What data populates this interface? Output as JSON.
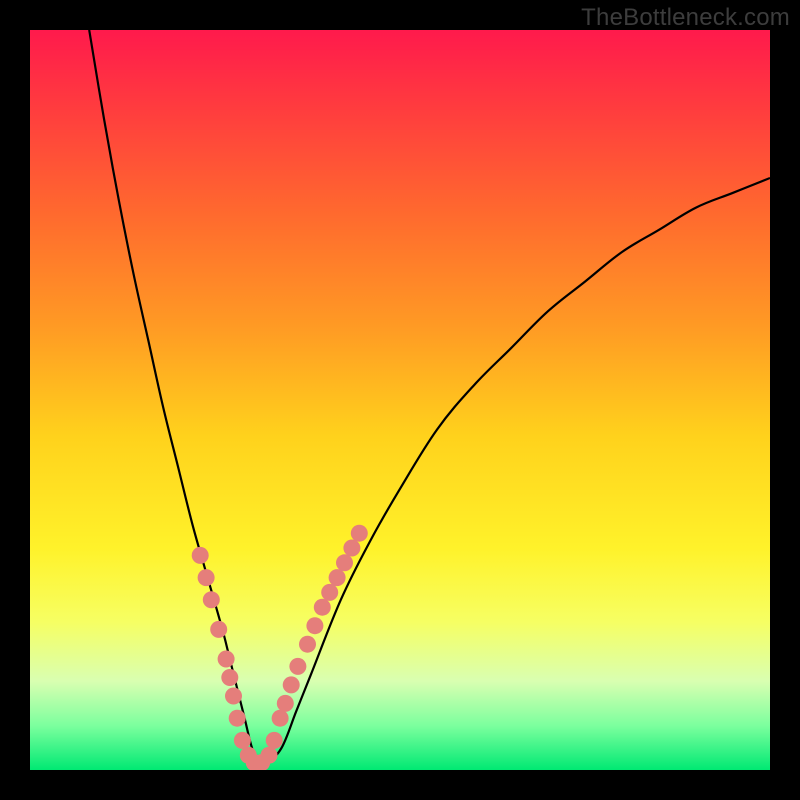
{
  "watermark": "TheBottleneck.com",
  "colors": {
    "background": "#000000",
    "curve_stroke": "#000000",
    "dot_fill": "#e57e7b",
    "gradient_stops": [
      {
        "offset": 0.0,
        "color": "#ff1a4c"
      },
      {
        "offset": 0.1,
        "color": "#ff3a3f"
      },
      {
        "offset": 0.25,
        "color": "#ff6a2e"
      },
      {
        "offset": 0.4,
        "color": "#ff9a24"
      },
      {
        "offset": 0.55,
        "color": "#ffd21c"
      },
      {
        "offset": 0.7,
        "color": "#fff22a"
      },
      {
        "offset": 0.8,
        "color": "#f6ff63"
      },
      {
        "offset": 0.88,
        "color": "#d9ffb1"
      },
      {
        "offset": 0.94,
        "color": "#7cff9e"
      },
      {
        "offset": 1.0,
        "color": "#00e973"
      }
    ]
  },
  "chart_data": {
    "type": "line",
    "title": "",
    "xlabel": "",
    "ylabel": "",
    "xlim": [
      0,
      100
    ],
    "ylim": [
      0,
      100
    ],
    "series": [
      {
        "name": "bottleneck-curve",
        "x": [
          8,
          10,
          12,
          14,
          16,
          18,
          20,
          22,
          24,
          26,
          27,
          28,
          29,
          30,
          31,
          32,
          34,
          36,
          38,
          42,
          46,
          50,
          55,
          60,
          65,
          70,
          75,
          80,
          85,
          90,
          95,
          100
        ],
        "y": [
          100,
          88,
          77,
          67,
          58,
          49,
          41,
          33,
          26,
          19,
          15,
          11,
          7,
          3,
          1,
          1,
          3,
          8,
          13,
          23,
          31,
          38,
          46,
          52,
          57,
          62,
          66,
          70,
          73,
          76,
          78,
          80
        ]
      }
    ],
    "markers": {
      "name": "highlight-dots",
      "points": [
        {
          "x": 23.0,
          "y": 29
        },
        {
          "x": 23.8,
          "y": 26
        },
        {
          "x": 24.5,
          "y": 23
        },
        {
          "x": 25.5,
          "y": 19
        },
        {
          "x": 26.5,
          "y": 15
        },
        {
          "x": 27.0,
          "y": 12.5
        },
        {
          "x": 27.5,
          "y": 10
        },
        {
          "x": 28.0,
          "y": 7
        },
        {
          "x": 28.7,
          "y": 4
        },
        {
          "x": 29.5,
          "y": 2
        },
        {
          "x": 30.3,
          "y": 1
        },
        {
          "x": 31.3,
          "y": 1
        },
        {
          "x": 32.3,
          "y": 2
        },
        {
          "x": 33.0,
          "y": 4
        },
        {
          "x": 33.8,
          "y": 7
        },
        {
          "x": 34.5,
          "y": 9
        },
        {
          "x": 35.3,
          "y": 11.5
        },
        {
          "x": 36.2,
          "y": 14
        },
        {
          "x": 37.5,
          "y": 17
        },
        {
          "x": 38.5,
          "y": 19.5
        },
        {
          "x": 39.5,
          "y": 22
        },
        {
          "x": 40.5,
          "y": 24
        },
        {
          "x": 41.5,
          "y": 26
        },
        {
          "x": 42.5,
          "y": 28
        },
        {
          "x": 43.5,
          "y": 30
        },
        {
          "x": 44.5,
          "y": 32
        }
      ]
    }
  }
}
